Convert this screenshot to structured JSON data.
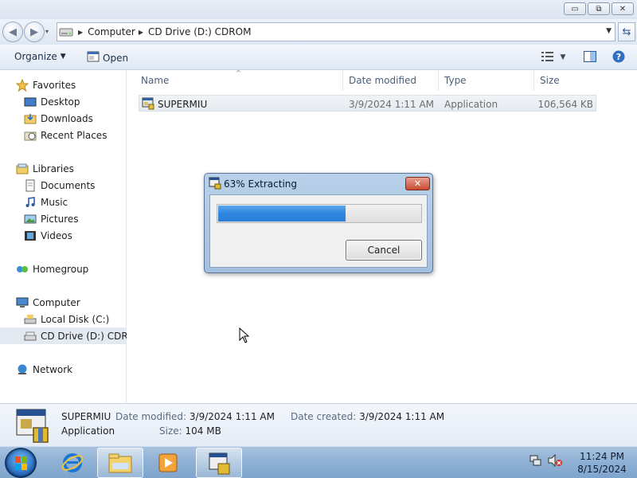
{
  "window": {
    "controls": {
      "minimize": "▭",
      "restore": "⧉",
      "close": "✕"
    }
  },
  "address": {
    "crumbs": [
      "Computer",
      "CD Drive (D:) CDROM"
    ]
  },
  "toolbar": {
    "organize_label": "Organize",
    "open_label": "Open"
  },
  "nav": {
    "favorites": "Favorites",
    "desktop": "Desktop",
    "downloads": "Downloads",
    "recent": "Recent Places",
    "libraries": "Libraries",
    "documents": "Documents",
    "music": "Music",
    "pictures": "Pictures",
    "videos": "Videos",
    "homegroup": "Homegroup",
    "computer": "Computer",
    "local_disk": "Local Disk (C:)",
    "cd_drive": "CD Drive (D:) CDROM",
    "network": "Network"
  },
  "columns": {
    "name": "Name",
    "date_modified": "Date modified",
    "type": "Type",
    "size": "Size"
  },
  "files": [
    {
      "name": "SUPERMIU",
      "date_modified": "3/9/2024 1:11 AM",
      "type": "Application",
      "size": "106,564 KB"
    }
  ],
  "details": {
    "name": "SUPERMIU",
    "type": "Application",
    "date_modified_label": "Date modified:",
    "date_modified": "3/9/2024 1:11 AM",
    "date_created_label": "Date created:",
    "date_created": "3/9/2024 1:11 AM",
    "size_label": "Size:",
    "size": "104 MB"
  },
  "dialog": {
    "title": "63% Extracting",
    "progress_percent": 63,
    "cancel_label": "Cancel"
  },
  "clock": {
    "time": "11:24 PM",
    "date": "8/15/2024"
  },
  "colors": {
    "progress_fill": "#2f86e0",
    "taskbar": "#8fb1d5"
  }
}
